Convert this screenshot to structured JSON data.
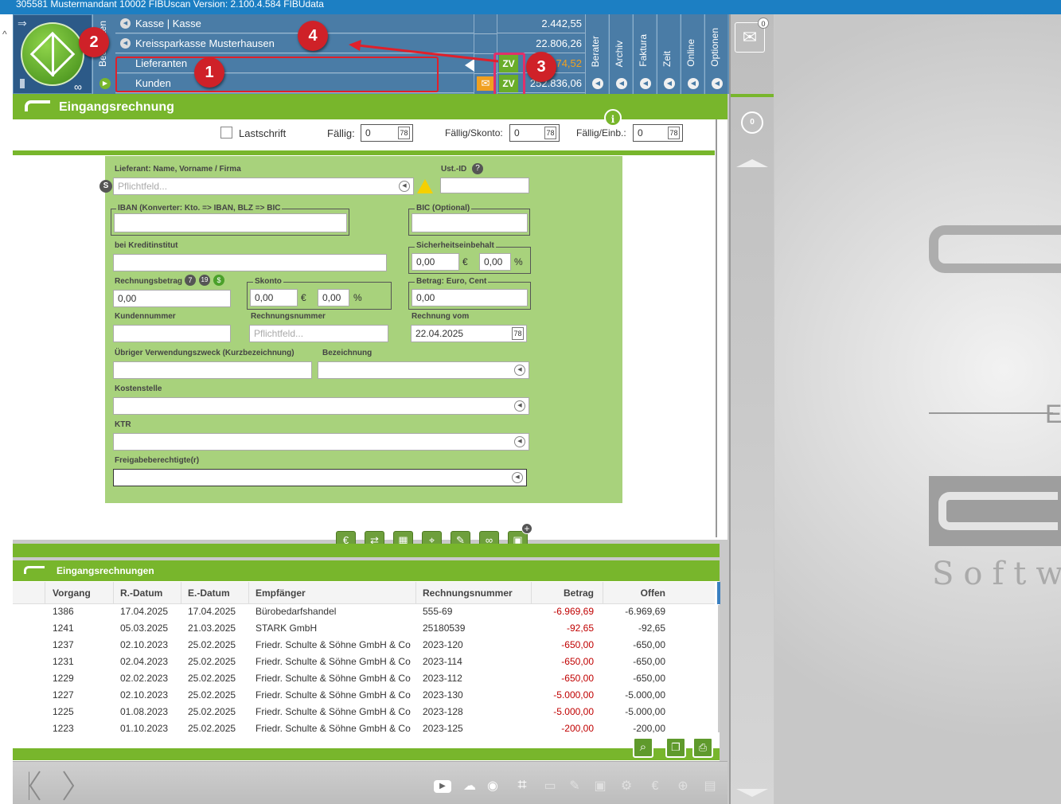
{
  "title": "305581 Mustermandant 10002 FIBUscan Version: 2.100.4.584 FIBUdata",
  "accounts": [
    {
      "label": "Kasse | Kasse",
      "value": "2.442,55"
    },
    {
      "label": "Kreissparkasse Musterhausen",
      "value": "22.806,26"
    },
    {
      "label": "Lieferanten",
      "value": "6.974,52"
    },
    {
      "label": "Kunden",
      "value": "252.836,06"
    }
  ],
  "zv_label": "ZV",
  "side_tabs": [
    "Bearbeiten",
    "Berater",
    "Archiv",
    "Faktura",
    "Zeit",
    "Online",
    "Optionen"
  ],
  "markers": [
    "1",
    "2",
    "3",
    "4"
  ],
  "mail_badge": "0",
  "right_counter": "0",
  "form": {
    "title": "Eingangsrechnung",
    "lastschrift": "Lastschrift",
    "faellig_label": "Fällig:",
    "faellig_value": "0",
    "faellig_skonto_label": "Fällig/Skonto:",
    "faellig_skonto_value": "0",
    "faellig_einb_label": "Fällig/Einb.:",
    "faellig_einb_value": "0",
    "cal_glyph": "78",
    "lieferant_label": "Lieferant: Name, Vorname / Firma",
    "pflichtfeld": "Pflichtfeld...",
    "ustid_label": "Ust.-ID",
    "iban_label": "IBAN (Konverter: Kto. => IBAN, BLZ => BIC",
    "bic_label": "BIC (Optional)",
    "kreditinstitut_label": "bei Kreditinstitut",
    "sicherheit_label": "Sicherheitseinbehalt",
    "sicherheit_eur": "0,00",
    "sicherheit_pct": "0,00",
    "rechnungsbetrag_label": "Rechnungsbetrag",
    "rechnungsbetrag_value": "0,00",
    "badge7": "7",
    "badge19": "19",
    "skonto_label": "Skonto",
    "skonto_eur": "0,00",
    "skonto_pct": "0,00",
    "betrag_label": "Betrag: Euro, Cent",
    "betrag_value": "0,00",
    "eur": "€",
    "pct": "%",
    "kundennummer_label": "Kundennummer",
    "rechnungsnummer_label": "Rechnungsnummer",
    "rechnung_vom_label": "Rechnung vom",
    "rechnung_vom_value": "22.04.2025",
    "verwendung_label": "Übriger Verwendungszweck (Kurzbezeichnung)",
    "bezeichnung_label": "Bezeichnung",
    "kostenstelle_label": "Kostenstelle",
    "ktr_label": "KTR",
    "freigabe_label": "Freigabeberechtigte(r)"
  },
  "list": {
    "title": "Eingangsrechnungen",
    "columns": [
      "Vorgang",
      "R.-Datum",
      "E.-Datum",
      "Empfänger",
      "Rechnungsnummer",
      "Betrag",
      "Offen"
    ],
    "rows": [
      [
        "1386",
        "17.04.2025",
        "17.04.2025",
        "Bürobedarfshandel",
        "555-69",
        "-6.969,69",
        "-6.969,69"
      ],
      [
        "1241",
        "05.03.2025",
        "21.03.2025",
        "STARK GmbH",
        "25180539",
        "-92,65",
        "-92,65"
      ],
      [
        "1237",
        "02.10.2023",
        "25.02.2025",
        "Friedr. Schulte & Söhne GmbH & Co",
        "2023-120",
        "-650,00",
        "-650,00"
      ],
      [
        "1231",
        "02.04.2023",
        "25.02.2025",
        "Friedr. Schulte & Söhne GmbH & Co",
        "2023-114",
        "-650,00",
        "-650,00"
      ],
      [
        "1229",
        "02.02.2023",
        "25.02.2025",
        "Friedr. Schulte & Söhne GmbH & Co",
        "2023-112",
        "-650,00",
        "-650,00"
      ],
      [
        "1227",
        "02.10.2023",
        "25.02.2025",
        "Friedr. Schulte & Söhne GmbH & Co",
        "2023-130",
        "-5.000,00",
        "-5.000,00"
      ],
      [
        "1225",
        "01.08.2023",
        "25.02.2025",
        "Friedr. Schulte & Söhne GmbH & Co",
        "2023-128",
        "-5.000,00",
        "-5.000,00"
      ],
      [
        "1223",
        "01.10.2023",
        "25.02.2025",
        "Friedr. Schulte & Söhne GmbH & Co",
        "2023-125",
        "-200,00",
        "-200,00"
      ]
    ]
  },
  "brand": {
    "software": "Softwa",
    "letter": "E"
  }
}
